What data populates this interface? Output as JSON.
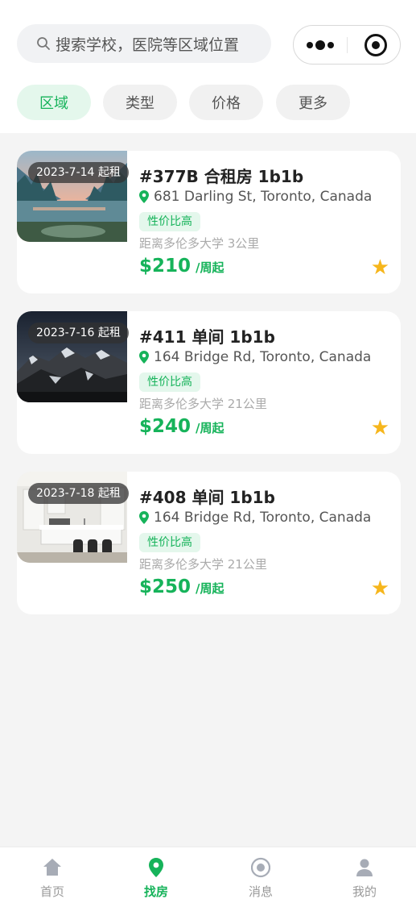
{
  "search": {
    "placeholder": "搜索学校，医院等区域位置"
  },
  "filters": [
    "区域",
    "类型",
    "价格",
    "更多"
  ],
  "listings": [
    {
      "date_badge": "2023-7-14 起租",
      "title": "#377B 合租房 1b1b",
      "address": "681 Darling St, Toronto, Canada",
      "tag": "性价比高",
      "distance": "距离多伦多大学 3公里",
      "price": "$210",
      "unit": "/周起",
      "image": "lake-mountain-sunset"
    },
    {
      "date_badge": "2023-7-16 起租",
      "title": "#411 单间 1b1b",
      "address": "164 Bridge Rd, Toronto, Canada",
      "tag": "性价比高",
      "distance": "距离多伦多大学 21公里",
      "price": "$240",
      "unit": "/周起",
      "image": "snowy-mountains-night"
    },
    {
      "date_badge": "2023-7-18 起租",
      "title": "#408 单间 1b1b",
      "address": "164 Bridge Rd, Toronto, Canada",
      "tag": "性价比高",
      "distance": "距离多伦多大学 21公里",
      "price": "$250",
      "unit": "/周起",
      "image": "white-kitchen"
    }
  ],
  "tabbar": [
    {
      "label": "首页",
      "icon": "home-icon"
    },
    {
      "label": "找房",
      "icon": "location-pin-icon"
    },
    {
      "label": "消息",
      "icon": "message-circle-icon"
    },
    {
      "label": "我的",
      "icon": "user-icon"
    }
  ],
  "colors": {
    "accent": "#16b35a",
    "star": "#f6b61c",
    "chip_active_bg": "#e4f7ec"
  }
}
